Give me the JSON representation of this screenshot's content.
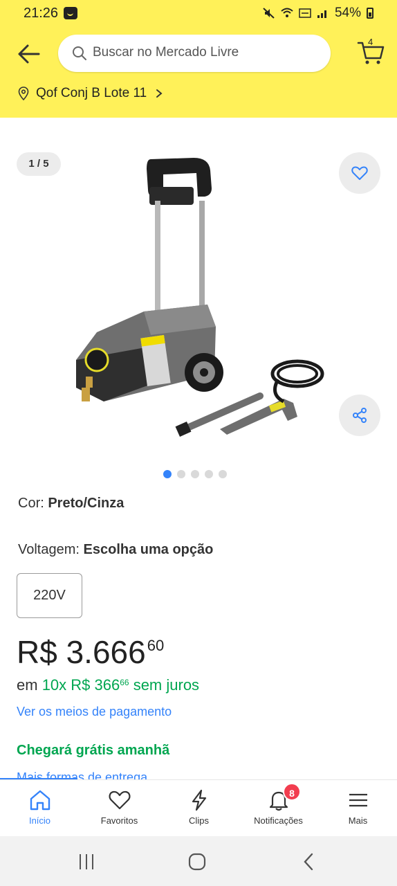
{
  "status_bar": {
    "time": "21:26",
    "battery": "54%"
  },
  "header": {
    "search_placeholder": "Buscar no Mercado Livre",
    "cart_count": "4",
    "location": "Qof Conj B Lote 11"
  },
  "gallery": {
    "counter": "1 / 5",
    "total_images": 5,
    "active_index": 0
  },
  "variations": {
    "cor_label": "Cor: ",
    "cor_value": "Preto/Cinza",
    "voltagem_label": "Voltagem: ",
    "voltagem_value": "Escolha uma opção",
    "option": "220V"
  },
  "price": {
    "main": "R$ 3.666",
    "cents": "60",
    "installments_prefix": "em ",
    "installments_value": "10x R$ 366",
    "installments_cents": "66",
    "installments_suffix": " sem juros",
    "payment_link": "Ver os meios de pagamento"
  },
  "shipping": {
    "headline": "Chegará grátis amanhã",
    "more_options": "Mais formas de entrega"
  },
  "bottom_nav": {
    "items": [
      {
        "label": "Início"
      },
      {
        "label": "Favoritos"
      },
      {
        "label": "Clips"
      },
      {
        "label": "Notificações",
        "badge": "8"
      },
      {
        "label": "Mais"
      }
    ]
  },
  "colors": {
    "header_yellow": "#fff159",
    "accent_blue": "#3483fa",
    "green": "#00a650",
    "badge_red": "#f23d4f"
  }
}
